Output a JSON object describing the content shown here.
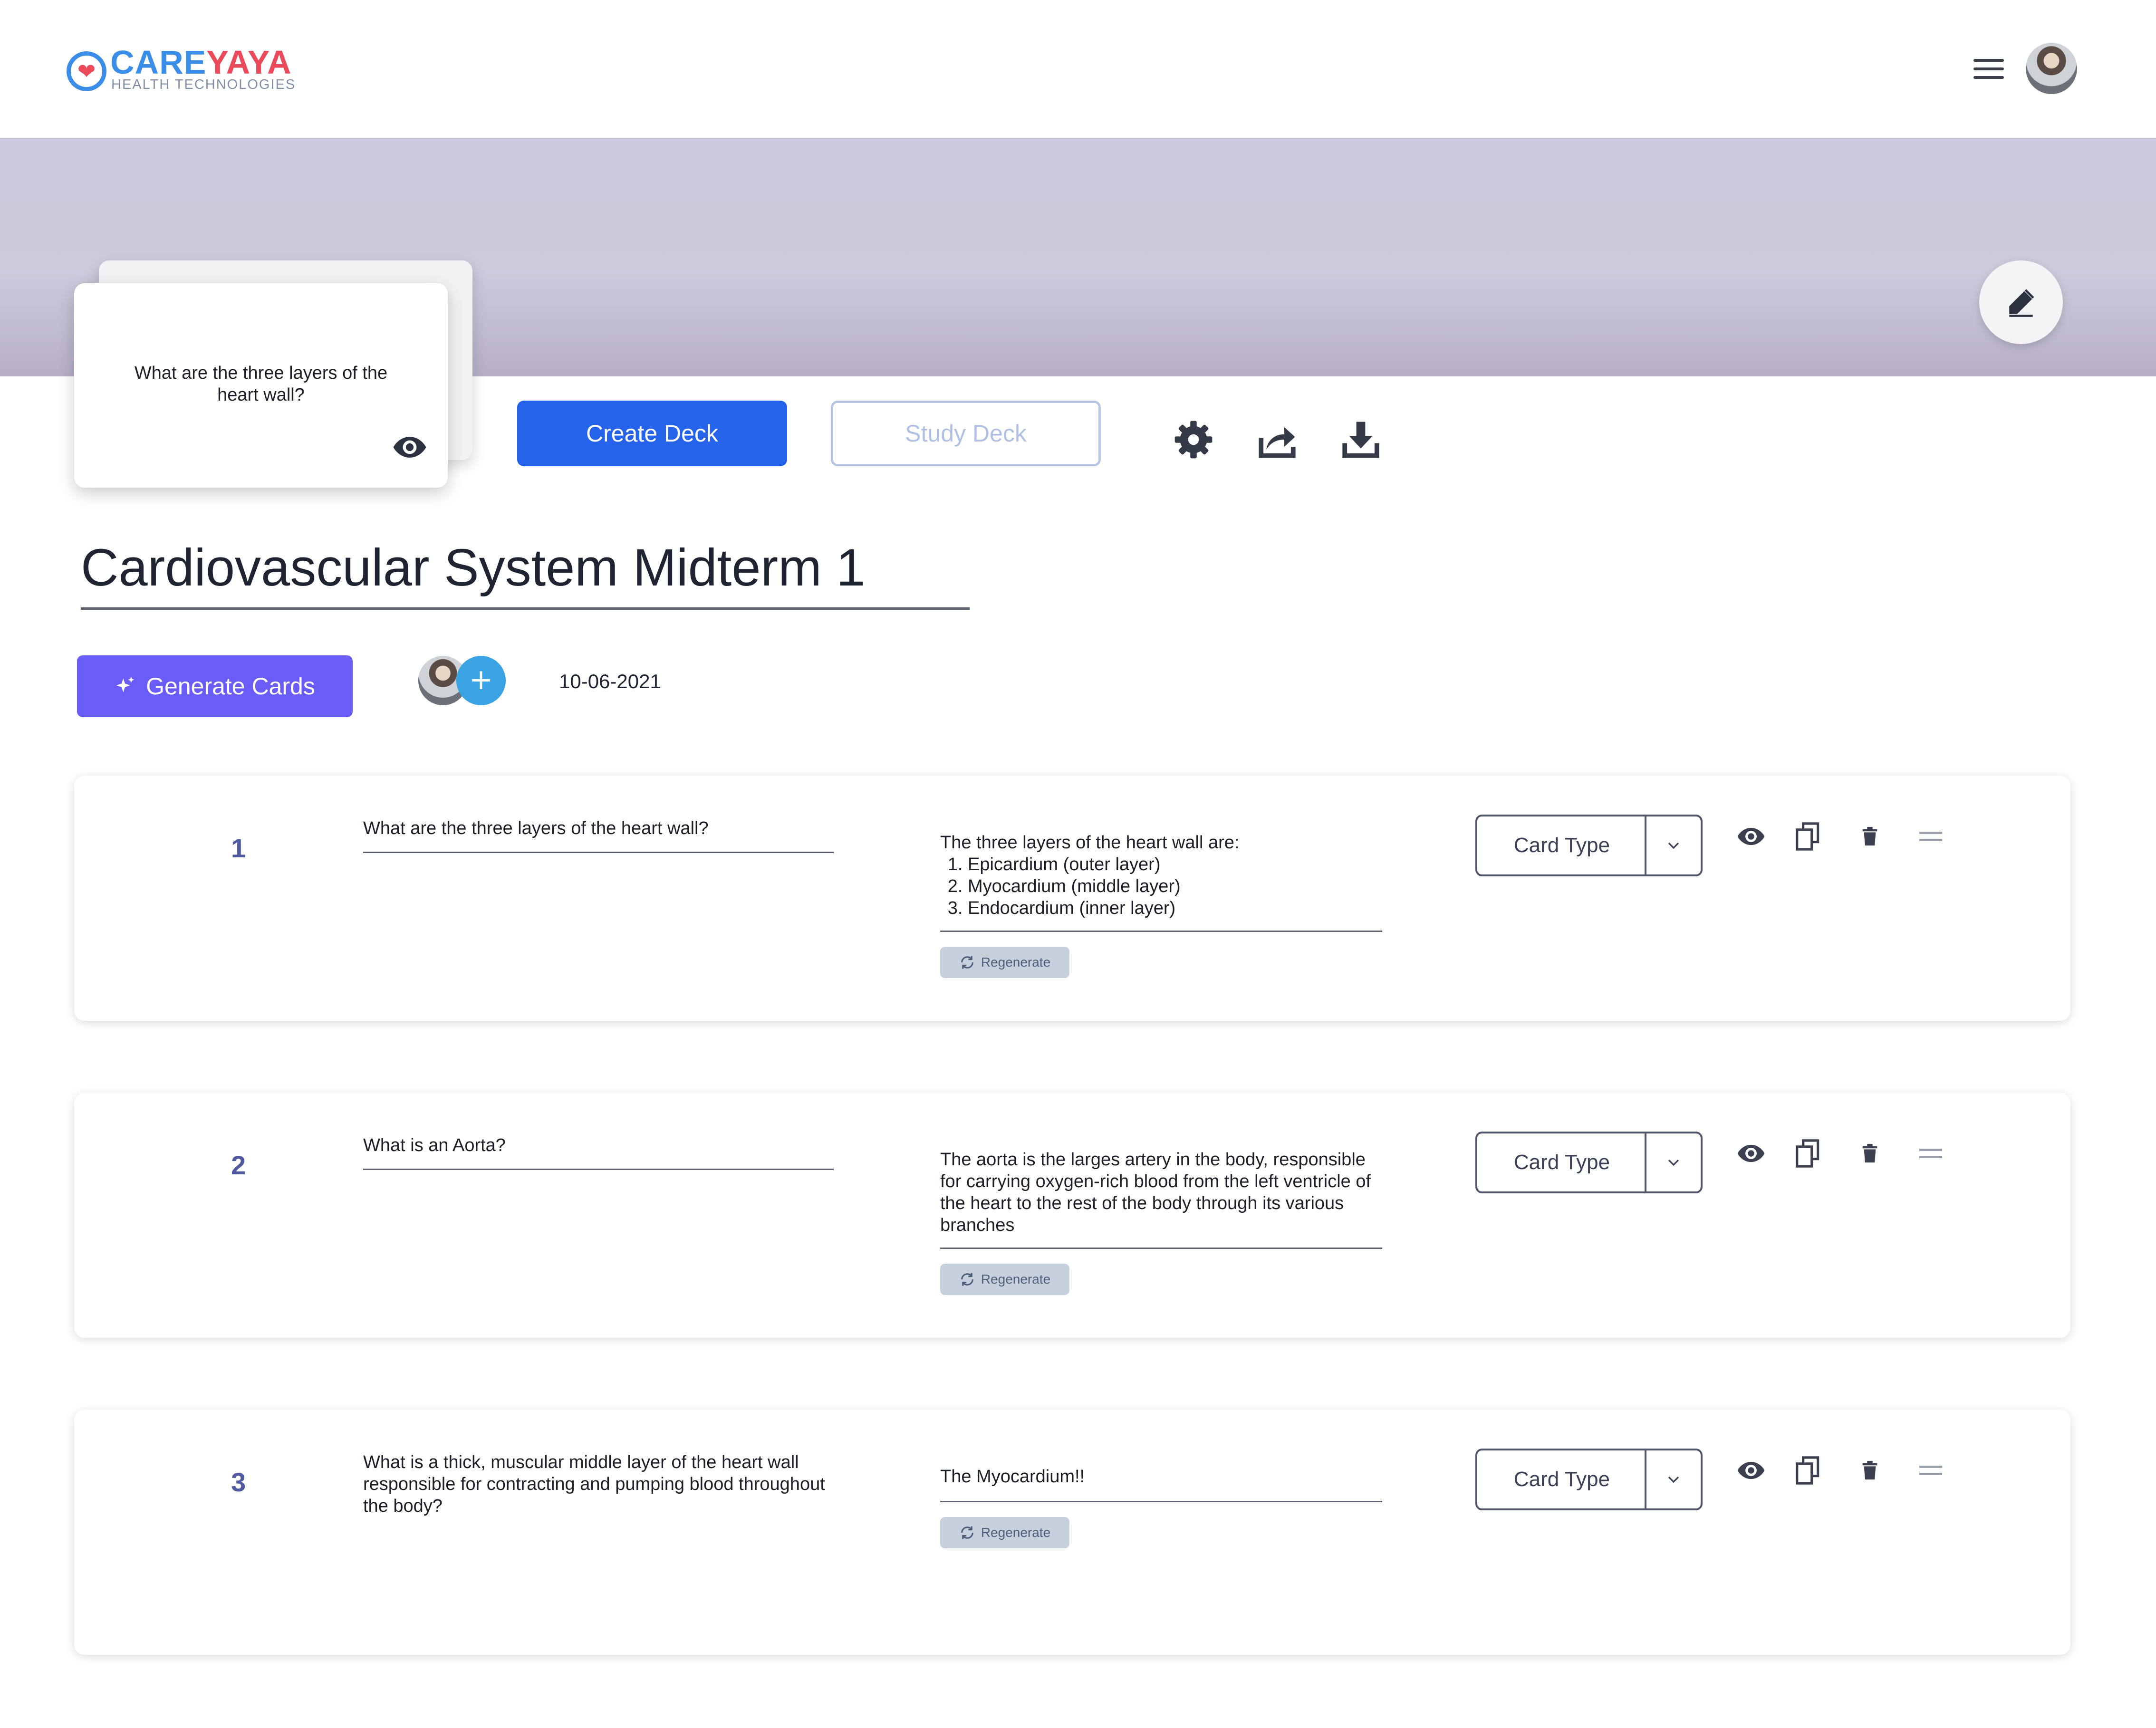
{
  "brand": {
    "name_part1": "CARE",
    "name_part2": "YAYA",
    "tagline": "HEALTH TECHNOLOGIES"
  },
  "header": {
    "menu_icon": "hamburger-menu-icon",
    "avatar_icon": "user-avatar"
  },
  "banner": {
    "edit_icon": "pencil-icon"
  },
  "preview_card": {
    "question": "What are the three layers of the heart wall?",
    "icon": "eye-icon"
  },
  "actions": {
    "create_deck": "Create Deck",
    "study_deck": "Study Deck",
    "icons": [
      "gear-icon",
      "share-icon",
      "download-icon"
    ]
  },
  "deck": {
    "title": "Cardiovascular System Midterm 1",
    "generate_label": "Generate Cards",
    "generate_icon": "sparkle-icon",
    "add_collaborator": "+",
    "date": "10-06-2021"
  },
  "cards": [
    {
      "number": "1",
      "question": "What are the three layers of the heart wall?",
      "answer_intro": "The three layers of the heart wall are:",
      "answer_items": [
        "Epicardium (outer layer)",
        "Myocardium (middle layer)",
        "Endocardium (inner layer)"
      ],
      "regenerate": "Regenerate",
      "card_type": "Card Type"
    },
    {
      "number": "2",
      "question": "What is an Aorta?",
      "answer": "The aorta is the larges artery in the body, responsible for carrying oxygen-rich blood from the left ventricle of the heart to the rest of the body through its various branches",
      "regenerate": "Regenerate",
      "card_type": "Card Type"
    },
    {
      "number": "3",
      "question": "What is a thick, muscular middle layer of the heart wall responsible for contracting and pumping blood throughout the body?",
      "answer": "The Myocardium!!",
      "regenerate": "Regenerate",
      "card_type": "Card Type"
    }
  ],
  "row_icons": [
    "eye-icon",
    "copy-icon",
    "trash-icon",
    "drag-handle-icon"
  ],
  "colors": {
    "primary": "#2563eb",
    "generate": "#6a5cf6",
    "brand_blue": "#3b8ee8",
    "brand_red": "#ea4a5a",
    "banner": "#cbc9dd",
    "number": "#4f5aa0"
  }
}
